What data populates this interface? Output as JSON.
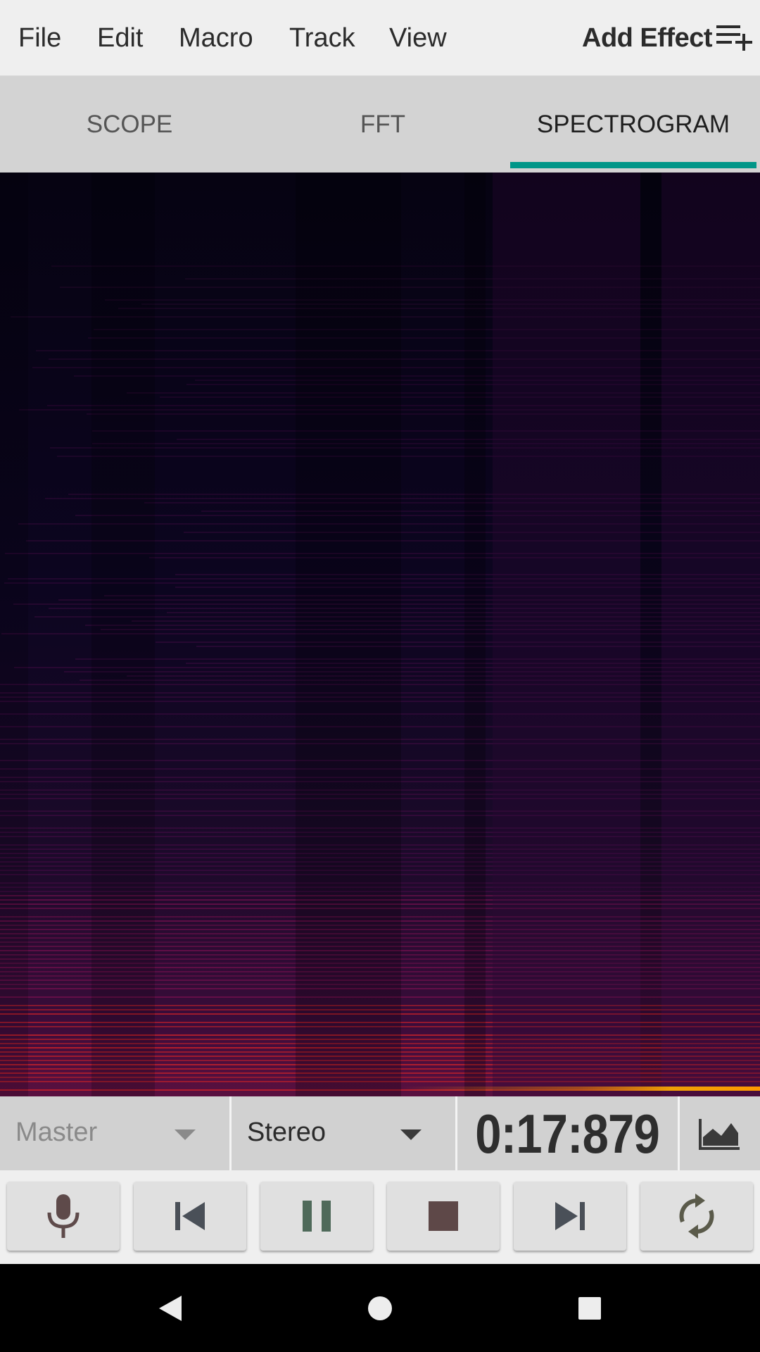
{
  "menu": {
    "items": [
      "File",
      "Edit",
      "Macro",
      "Track",
      "View"
    ],
    "add_effect": "Add Effect"
  },
  "tabs": [
    {
      "label": "SCOPE",
      "active": false
    },
    {
      "label": "FFT",
      "active": false
    },
    {
      "label": "SPECTROGRAM",
      "active": true
    }
  ],
  "spectrogram": {
    "colormap": [
      "#060312",
      "#3a0a3a",
      "#7a1050",
      "#c0202a",
      "#ff8a00",
      "#ffd200"
    ]
  },
  "selectors": {
    "track": "Master",
    "channel": "Stereo",
    "time": "0:17:879"
  },
  "transport": {
    "buttons": [
      "microphone-icon",
      "skip-back-icon",
      "pause-icon",
      "stop-icon",
      "skip-forward-icon",
      "loop-icon"
    ]
  },
  "navigation": {
    "buttons": [
      "back-icon",
      "home-icon",
      "recents-icon"
    ]
  },
  "colors": {
    "accent": "#009688",
    "menu_bg": "#efefef",
    "tab_bg": "#d3d3d3",
    "icon_dark": "#5a5a5a",
    "pause_icon": "#4f6a5a",
    "stop_icon": "#5e4848"
  }
}
